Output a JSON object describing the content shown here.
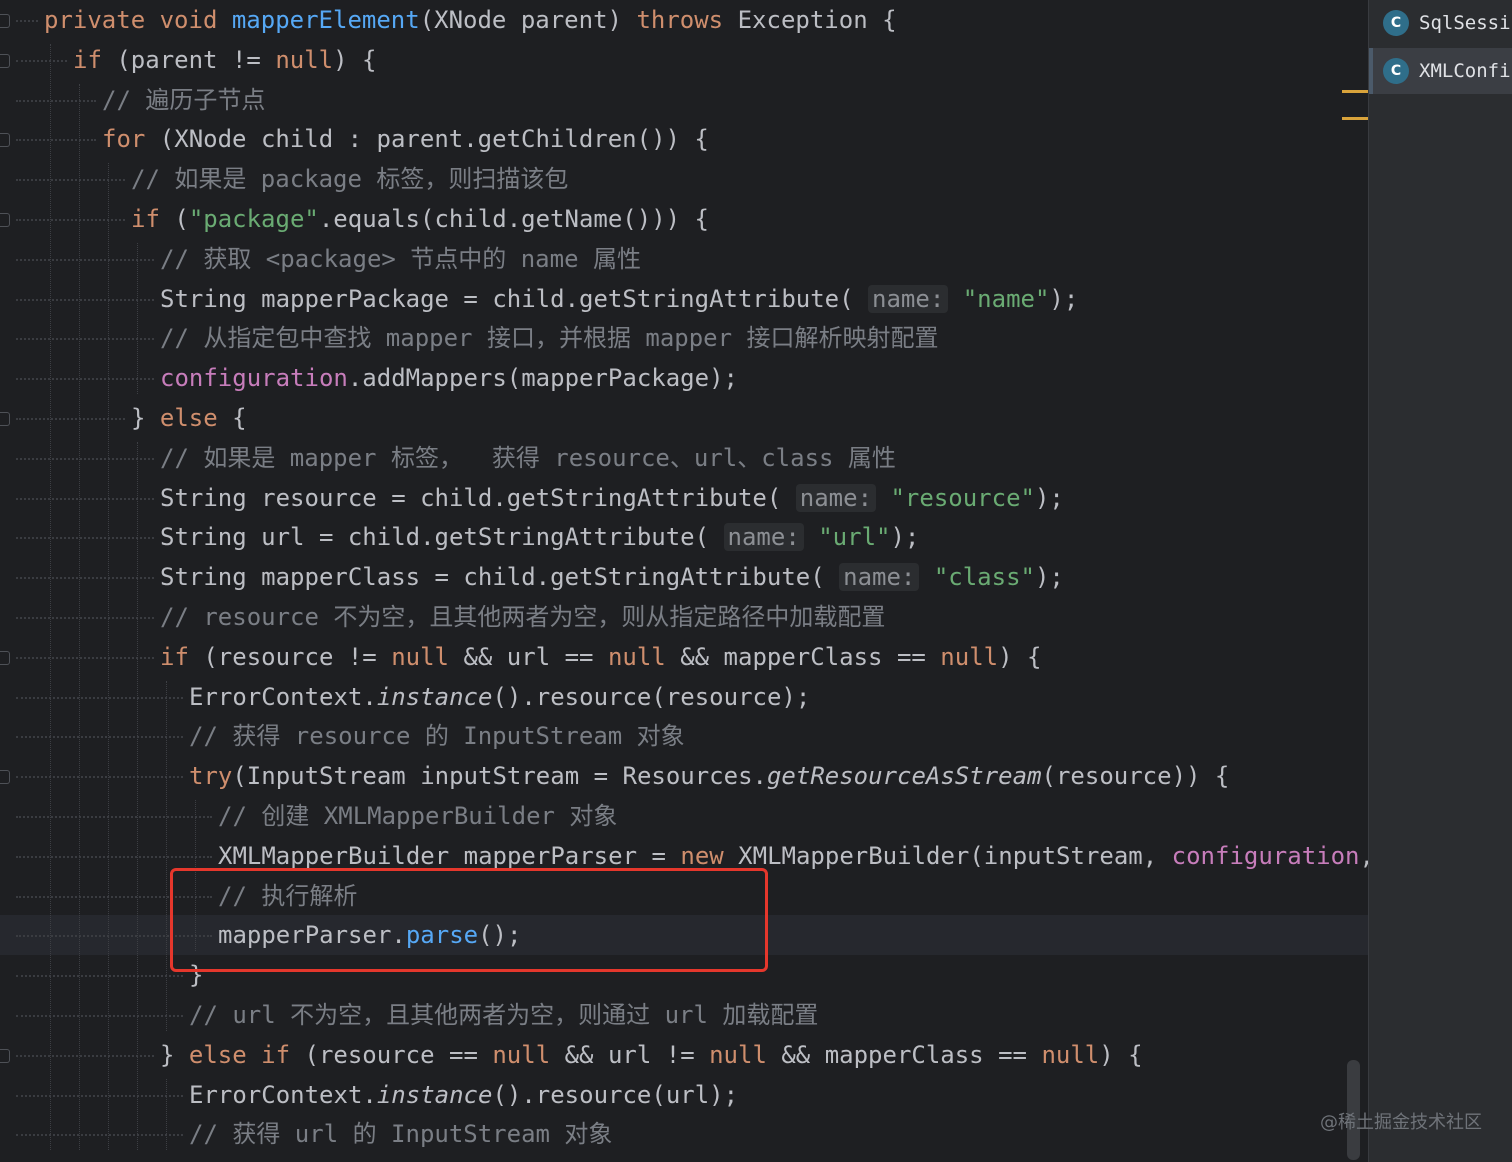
{
  "editor": {
    "lines": [
      [
        [
          "kw",
          "private "
        ],
        [
          "kw",
          "void "
        ],
        [
          "fn",
          "mapperElement"
        ],
        [
          "p",
          "(XNode parent) "
        ],
        [
          "kw",
          "throws "
        ],
        [
          "p",
          "Exception {"
        ]
      ],
      [
        [
          "kw",
          "if "
        ],
        [
          "p",
          "(parent != "
        ],
        [
          "kw",
          "null"
        ],
        [
          "p",
          ") {"
        ]
      ],
      [
        [
          "cm",
          "// 遍历子节点"
        ]
      ],
      [
        [
          "kw",
          "for "
        ],
        [
          "p",
          "(XNode child : parent.getChildren()) {"
        ]
      ],
      [
        [
          "cm",
          "// 如果是 package 标签，则扫描该包"
        ]
      ],
      [
        [
          "kw",
          "if "
        ],
        [
          "p",
          "("
        ],
        [
          "str",
          "\"package\""
        ],
        [
          "p",
          ".equals(child.getName())) {"
        ]
      ],
      [
        [
          "cm",
          "// 获取 <package> 节点中的 name 属性"
        ]
      ],
      [
        [
          "p",
          "String mapperPackage = child.getStringAttribute( "
        ],
        [
          "hint",
          "name:"
        ],
        [
          "p",
          " "
        ],
        [
          "str",
          "\"name\""
        ],
        [
          "p",
          ");"
        ]
      ],
      [
        [
          "cm",
          "// 从指定包中查找 mapper 接口，并根据 mapper 接口解析映射配置"
        ]
      ],
      [
        [
          "fld",
          "configuration"
        ],
        [
          "p",
          ".addMappers(mapperPackage);"
        ]
      ],
      [
        [
          "p",
          "} "
        ],
        [
          "kw",
          "else "
        ],
        [
          "p",
          "{"
        ]
      ],
      [
        [
          "cm",
          "// 如果是 mapper 标签，  获得 resource、url、class 属性"
        ]
      ],
      [
        [
          "p",
          "String resource = child.getStringAttribute( "
        ],
        [
          "hint",
          "name:"
        ],
        [
          "p",
          " "
        ],
        [
          "str",
          "\"resource\""
        ],
        [
          "p",
          ");"
        ]
      ],
      [
        [
          "p",
          "String url = child.getStringAttribute( "
        ],
        [
          "hint",
          "name:"
        ],
        [
          "p",
          " "
        ],
        [
          "str",
          "\"url\""
        ],
        [
          "p",
          ");"
        ]
      ],
      [
        [
          "p",
          "String mapperClass = child.getStringAttribute( "
        ],
        [
          "hint",
          "name:"
        ],
        [
          "p",
          " "
        ],
        [
          "str",
          "\"class\""
        ],
        [
          "p",
          ");"
        ]
      ],
      [
        [
          "cm",
          "// resource 不为空，且其他两者为空，则从指定路径中加载配置"
        ]
      ],
      [
        [
          "kw",
          "if "
        ],
        [
          "p",
          "(resource != "
        ],
        [
          "kw",
          "null "
        ],
        [
          "p",
          "&& url == "
        ],
        [
          "kw",
          "null "
        ],
        [
          "p",
          "&& mapperClass == "
        ],
        [
          "kw",
          "null"
        ],
        [
          "p",
          ") {"
        ]
      ],
      [
        [
          "p",
          "ErrorContext."
        ],
        [
          "it",
          "instance"
        ],
        [
          "p",
          "().resource(resource);"
        ]
      ],
      [
        [
          "cm",
          "// 获得 resource 的 InputStream 对象"
        ]
      ],
      [
        [
          "kw",
          "try"
        ],
        [
          "p",
          "(InputStream inputStream = Resources."
        ],
        [
          "it",
          "getResourceAsStream"
        ],
        [
          "p",
          "(resource)) {"
        ]
      ],
      [
        [
          "cm",
          "// 创建 XMLMapperBuilder 对象"
        ]
      ],
      [
        [
          "p",
          "XMLMapperBuilder mapperParser = "
        ],
        [
          "kw",
          "new "
        ],
        [
          "p",
          "XMLMapperBuilder(inputStream, "
        ],
        [
          "fld",
          "configuration"
        ],
        [
          "p",
          ","
        ]
      ],
      [
        [
          "cm",
          "// 执行解析"
        ]
      ],
      [
        [
          "p",
          "mapperParser."
        ],
        [
          "fn",
          "parse"
        ],
        [
          "p",
          "();"
        ]
      ],
      [
        [
          "p",
          "}"
        ]
      ],
      [
        [
          "cm",
          "// url 不为空，且其他两者为空，则通过 url 加载配置"
        ]
      ],
      [
        [
          "p",
          "} "
        ],
        [
          "kw",
          "else if "
        ],
        [
          "p",
          "(resource == "
        ],
        [
          "kw",
          "null "
        ],
        [
          "p",
          "&& url != "
        ],
        [
          "kw",
          "null "
        ],
        [
          "p",
          "&& mapperClass == "
        ],
        [
          "kw",
          "null"
        ],
        [
          "p",
          ") {"
        ]
      ],
      [
        [
          "p",
          "ErrorContext."
        ],
        [
          "it",
          "instance"
        ],
        [
          "p",
          "().resource(url);"
        ]
      ],
      [
        [
          "cm",
          "// 获得 url 的 InputStream 对象"
        ]
      ]
    ]
  },
  "side_panel": {
    "items": [
      {
        "icon": "class-icon",
        "icon_letter": "C",
        "label": "SqlSessi"
      },
      {
        "icon": "class-icon",
        "icon_letter": "C",
        "label": "XMLConfi"
      }
    ]
  },
  "watermark": "@稀土掘金技术社区",
  "colors": {
    "background": "#1e1f22",
    "keyword": "#cf8e6d",
    "string": "#6aab73",
    "comment": "#7a7e85",
    "field": "#c77dbb",
    "method": "#56a8f5",
    "highlight_box": "#e5372c"
  }
}
